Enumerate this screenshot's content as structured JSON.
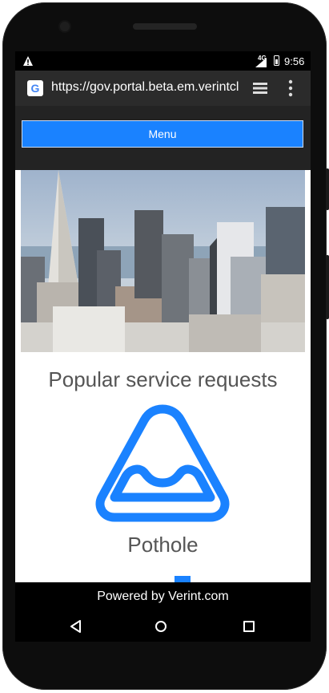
{
  "status_bar": {
    "time": "9:56",
    "network": "4G"
  },
  "browser": {
    "url": "https://gov.portal.beta.em.verintcl",
    "favicon": "G"
  },
  "page": {
    "menu_label": "Menu",
    "section_title": "Popular service requests",
    "service_item": {
      "label": "Pothole",
      "icon": "pothole-icon",
      "icon_color": "#1a82ff"
    },
    "footer": "Powered by Verint.com"
  },
  "colors": {
    "accent": "#1a82ff",
    "header_bg": "#232323",
    "footer_bg": "#000000"
  }
}
